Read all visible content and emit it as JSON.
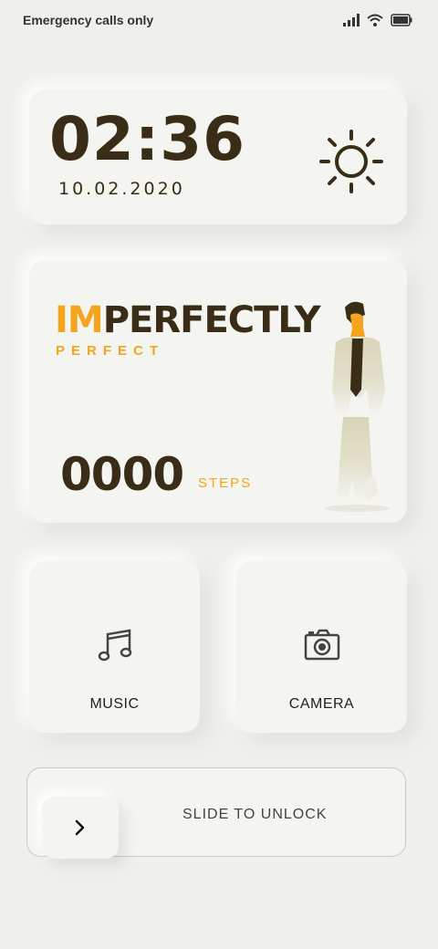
{
  "status_bar": {
    "carrier_text": "Emergency calls only",
    "icons": [
      "signal-icon",
      "wifi-icon",
      "battery-icon"
    ]
  },
  "clock": {
    "time": "02:36",
    "date": "10.02.2020",
    "weather_icon": "sun-icon"
  },
  "brand": {
    "title_accent": "IM",
    "title_rest": "PERFECTLY",
    "subtitle": "PERFECT",
    "steps_count": "0000",
    "steps_label": "STEPS"
  },
  "shortcuts": [
    {
      "label": "MUSIC",
      "icon": "music-note-icon"
    },
    {
      "label": "CAMERA",
      "icon": "camera-icon"
    }
  ],
  "unlock": {
    "label": "SLIDE TO UNLOCK",
    "icon": "chevron-right-icon"
  },
  "colors": {
    "background": "#efefec",
    "card": "#f4f4f1",
    "accent": "#f5a41d",
    "text_dark": "#3a2d17"
  }
}
